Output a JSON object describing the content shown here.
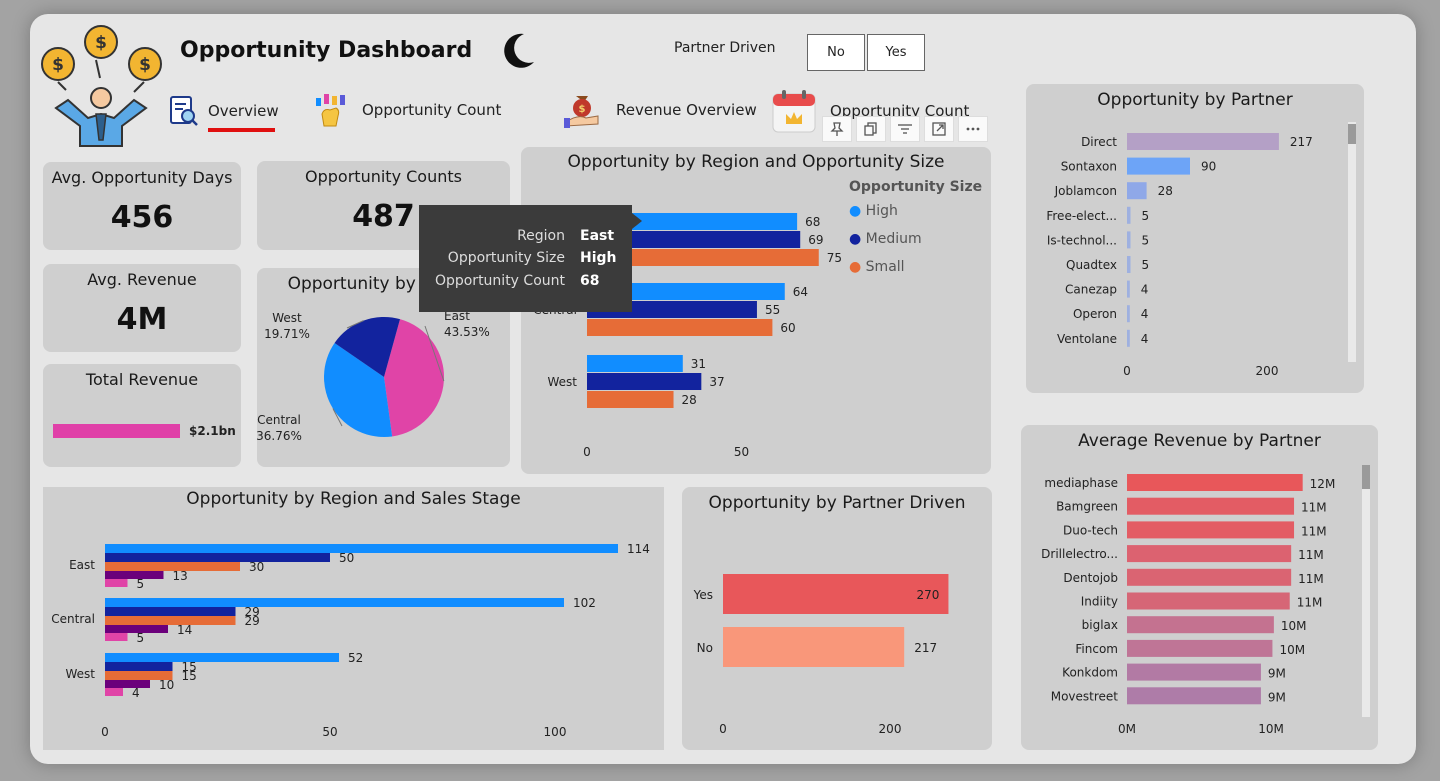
{
  "header": {
    "title": "Opportunity Dashboard",
    "filter_label": "Partner Driven",
    "filter_options": [
      "No",
      "Yes"
    ]
  },
  "nav": {
    "items": [
      {
        "label": "Overview",
        "icon": "report-search-icon",
        "active": true
      },
      {
        "label": "Opportunity Count",
        "icon": "hand-chart-icon"
      },
      {
        "label": "Revenue Overview",
        "icon": "money-bag-hand-icon"
      },
      {
        "label": "Opportunity Count",
        "icon": "calendar-crown-icon"
      }
    ],
    "active_color": "#e01010"
  },
  "kpis": {
    "avg_days": {
      "label": "Avg. Opportunity Days",
      "value": "456"
    },
    "counts": {
      "label": "Opportunity Counts",
      "value": "487"
    },
    "avg_revenue": {
      "label": "Avg. Revenue",
      "value": "4M"
    },
    "total_revenue": {
      "label": "Total Revenue",
      "value": "$2.1bn",
      "bar_color": "#e040a8"
    }
  },
  "visual_toolbar": [
    "pin-icon",
    "copy-icon",
    "filter-icon",
    "focus-mode-icon",
    "more-options-icon"
  ],
  "tooltip": {
    "rows": [
      {
        "key": "Region",
        "value": "East"
      },
      {
        "key": "Opportunity Size",
        "value": "High"
      },
      {
        "key": "Opportunity Count",
        "value": "68"
      }
    ]
  },
  "colors": {
    "high": "#118dff",
    "medium": "#12239e",
    "small": "#e66c37",
    "purple": "#6b007b",
    "pink": "#e044a7",
    "partner_bar": "#b4a0c6",
    "partner_blue": "#6da4f7"
  },
  "chart_data": [
    {
      "id": "region_size",
      "type": "bar",
      "title": "Opportunity by Region and Opportunity Size",
      "orientation": "horizontal",
      "categories": [
        "East",
        "Central",
        "West"
      ],
      "legend_title": "Opportunity Size",
      "series": [
        {
          "name": "High",
          "values": [
            68,
            64,
            31
          ]
        },
        {
          "name": "Medium",
          "values": [
            69,
            55,
            37
          ]
        },
        {
          "name": "Small",
          "values": [
            75,
            60,
            28
          ]
        }
      ],
      "xticks": [
        "0",
        "50"
      ],
      "xlim": [
        0,
        80
      ]
    },
    {
      "id": "region_pie",
      "type": "pie",
      "title": "Opportunity by Region",
      "slices": [
        {
          "label": "East",
          "pct": "43.53%",
          "value": 43.53,
          "color": "#e044a7"
        },
        {
          "label": "Central",
          "pct": "36.76%",
          "value": 36.76,
          "color": "#118dff"
        },
        {
          "label": "West",
          "pct": "19.71%",
          "value": 19.71,
          "color": "#12239e"
        }
      ]
    },
    {
      "id": "partner",
      "type": "bar",
      "title": "Opportunity by Partner",
      "orientation": "horizontal",
      "categories": [
        "Direct",
        "Sontaxon",
        "Joblamcon",
        "Free-elect...",
        "Is-technol...",
        "Quadtex",
        "Canezap",
        "Operon",
        "Ventolane"
      ],
      "values": [
        217,
        90,
        28,
        5,
        5,
        5,
        4,
        4,
        4
      ],
      "xticks": [
        "0",
        "200"
      ],
      "xlim": [
        0,
        250
      ]
    },
    {
      "id": "region_stage",
      "type": "bar",
      "title": "Opportunity by Region and Sales Stage",
      "orientation": "horizontal",
      "categories": [
        "East",
        "Central",
        "West"
      ],
      "series": [
        {
          "values": [
            114,
            102,
            52
          ]
        },
        {
          "values": [
            50,
            29,
            15
          ]
        },
        {
          "values": [
            30,
            29,
            15
          ]
        },
        {
          "values": [
            13,
            14,
            10
          ]
        },
        {
          "values": [
            5,
            5,
            4
          ]
        }
      ],
      "xticks": [
        "0",
        "50",
        "100"
      ],
      "xlim": [
        0,
        120
      ]
    },
    {
      "id": "partner_driven",
      "type": "bar",
      "title": "Opportunity by Partner Driven",
      "orientation": "horizontal",
      "categories": [
        "Yes",
        "No"
      ],
      "values": [
        270,
        217
      ],
      "xticks": [
        "0",
        "200"
      ],
      "xlim": [
        0,
        300
      ]
    },
    {
      "id": "avg_revenue_partner",
      "type": "bar",
      "title": "Average Revenue by Partner",
      "orientation": "horizontal",
      "categories": [
        "mediaphase",
        "Bamgreen",
        "Duo-tech",
        "Drillelectro...",
        "Dentojob",
        "Indiity",
        "biglax",
        "Fincom",
        "Konkdom",
        "Movestreet"
      ],
      "values": [
        12.2,
        11.6,
        11.6,
        11.4,
        11.4,
        11.3,
        10.2,
        10.1,
        9.3,
        9.3
      ],
      "value_labels": [
        "12M",
        "11M",
        "11M",
        "11M",
        "11M",
        "11M",
        "10M",
        "10M",
        "9M",
        "9M"
      ],
      "xticks": [
        "0M",
        "10M"
      ],
      "xlim": [
        0,
        15
      ]
    }
  ]
}
